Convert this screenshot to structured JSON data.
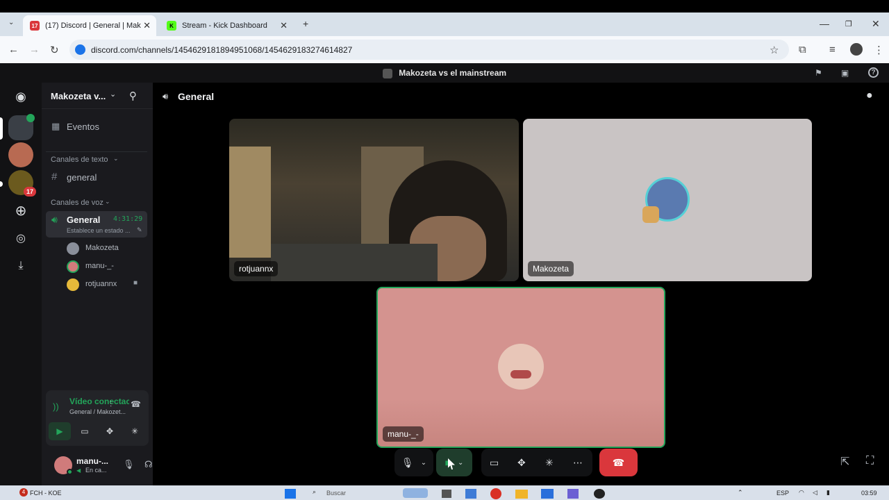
{
  "browser": {
    "tabs": [
      {
        "label": "(17) Discord | General | Mak",
        "active": true,
        "fav_text": "17"
      },
      {
        "label": "Stream - Kick Dashboard",
        "active": false,
        "fav_text": "K"
      }
    ],
    "new_tab": "+",
    "url": "discord.com/channels/1454629181894951068/1454629183274614827"
  },
  "discord": {
    "window_title": "Makozeta vs el mainstream",
    "server_name": "Makozeta v...",
    "events_label": "Eventos",
    "text_category": "Canales de texto",
    "text_channel": "general",
    "voice_category": "Canales de voz",
    "voice_channel": {
      "name": "General",
      "timer": "4:31:29",
      "status": "Establece un estado ..."
    },
    "voice_members": [
      {
        "name": "Makozeta",
        "color": "#8a8f9a"
      },
      {
        "name": "manu-_-",
        "color": "#d07b7b"
      },
      {
        "name": "rotjuannx",
        "color": "#e6b93a"
      }
    ],
    "server_badge": "17",
    "voice_panel": {
      "status": "Vídeo conectac",
      "location": "General / Makozet..."
    },
    "user": {
      "name": "manu-...",
      "status": "En ca..."
    },
    "header_channel": "General",
    "tiles": [
      {
        "name": "rotjuannx"
      },
      {
        "name": "Makozeta"
      },
      {
        "name": "manu-_-"
      }
    ],
    "colors": {
      "accent_green": "#23a55a",
      "end_call_red": "#da373c",
      "tile_pink": "#d4938f",
      "tile_grey": "#c9c4c4"
    }
  },
  "taskbar": {
    "app_label": "FCH - KOE",
    "badge": "4",
    "search_label": "Buscar",
    "lang": "ESP",
    "time": "03:59"
  }
}
